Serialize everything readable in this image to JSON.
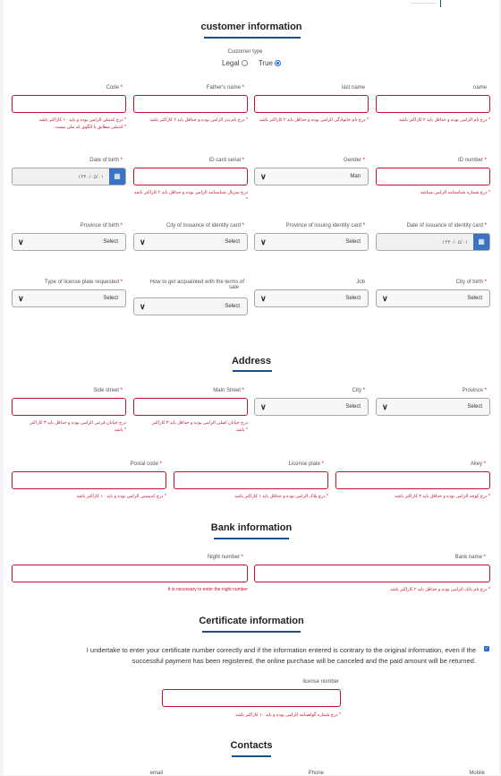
{
  "customer": {
    "title": "customer information",
    "type_label": "Customer type",
    "type_options": [
      "Legal",
      "True"
    ],
    "code": {
      "label": "Code",
      "error1": "درج کدملی الزامی بوده و باید ۱۰ کاراکتر باشد *",
      "error2": "کدملی مطابق با الگوی کد ملی نیست *"
    },
    "father": {
      "label": "Father's name",
      "error": "درج نام پدر الزامی بوده و حداقل باید ۲ کاراکتر باشد *"
    },
    "last": {
      "label": "last name",
      "error": "درج نام خانوادگی الزامی بوده و حداقل باید ۲ کاراکتر باشد *"
    },
    "name": {
      "label": "name",
      "error": "درج نام الزامی بوده و حداقل باید ۲ کاراکتر باشد *"
    },
    "dob": {
      "label": "Date of birth",
      "value": "۱۳۴۰/۰۵/۰۱"
    },
    "serial": {
      "label": "ID card serial",
      "error": "درج سریال شناسنامه الزامی بوده و حداقل باید ۲ کاراکتر باشد *"
    },
    "gender": {
      "label": "Gender",
      "value": "Man"
    },
    "idnum": {
      "label": "ID number",
      "error": "درج شماره شناسنامه الزامی میباشد *"
    },
    "prov_birth": {
      "label": "Province of birth",
      "value": "Select"
    },
    "city_issue": {
      "label": "City of issuance of identity card",
      "value": "Select"
    },
    "prov_issue": {
      "label": "Province of issuing identity card",
      "value": "Select"
    },
    "date_issue": {
      "label": "Date of issuance of identity card",
      "value": "۱۳۴۰/۰۵/۰۱"
    },
    "plate_type": {
      "label": "Type of license plate requested",
      "value": "Select"
    },
    "acquaint": {
      "label1": "How to get acquainted with the terms of",
      "label2": "sale",
      "value": "Select"
    },
    "job": {
      "label": "Job",
      "value": "Select"
    },
    "city_birth": {
      "label": "City of birth",
      "value": "Select"
    }
  },
  "address": {
    "title": "Address",
    "side": {
      "label": "Side street",
      "error1": "درج خیابان فرعی الزامی بوده و حداقل باید ۳ کاراکتر",
      "error2": "باشد *"
    },
    "main": {
      "label": "Main Street",
      "error1": "درج خیابان اصلی الزامی بوده و حداقل باید ۳ کاراکتر",
      "error2": "باشد *"
    },
    "city": {
      "label": "City",
      "value": "Select"
    },
    "province": {
      "label": "Province",
      "value": "Select"
    },
    "postal": {
      "label": "Postal code",
      "error": "درج کدپستی الزامی بوده و باید ۱۰ کاراکتر باشد *"
    },
    "plate": {
      "label": "License plate",
      "error": "درج پلاک الزامی بوده و حداقل باید ۱ کاراکتر باشد *"
    },
    "alley": {
      "label": "Alley",
      "error": "درج کوچه الزامی بوده و حداقل باید ۳ کاراکتر باشد *"
    }
  },
  "bank": {
    "title": "Bank information",
    "night": {
      "label": "Night number",
      "error": "It is necessary to enter the night number"
    },
    "bankname": {
      "label": "Bank name",
      "error": "درج نام بانک الزامی بوده و حداقل باید ۲ کاراکتر باشد *"
    }
  },
  "certificate": {
    "title": "Certificate information",
    "note1": "I undertake to enter your certificate number correctly and if the information entered is contrary to the original information, even if the",
    "note2": "successful payment has been registered, the online purchase will be canceled and the paid amount will be returned.",
    "license": {
      "label": "license number",
      "error": "درج شماره گواهینامه الزامی بوده و باید ۱۰ کاراکتر باشد *"
    }
  },
  "contacts": {
    "title": "Contacts",
    "email": "email",
    "phone": "Phone",
    "mobile": "Mobile"
  },
  "colors": {
    "accent": "#1b4f8a",
    "error": "#c8102e",
    "primary": "#3b73c4"
  }
}
